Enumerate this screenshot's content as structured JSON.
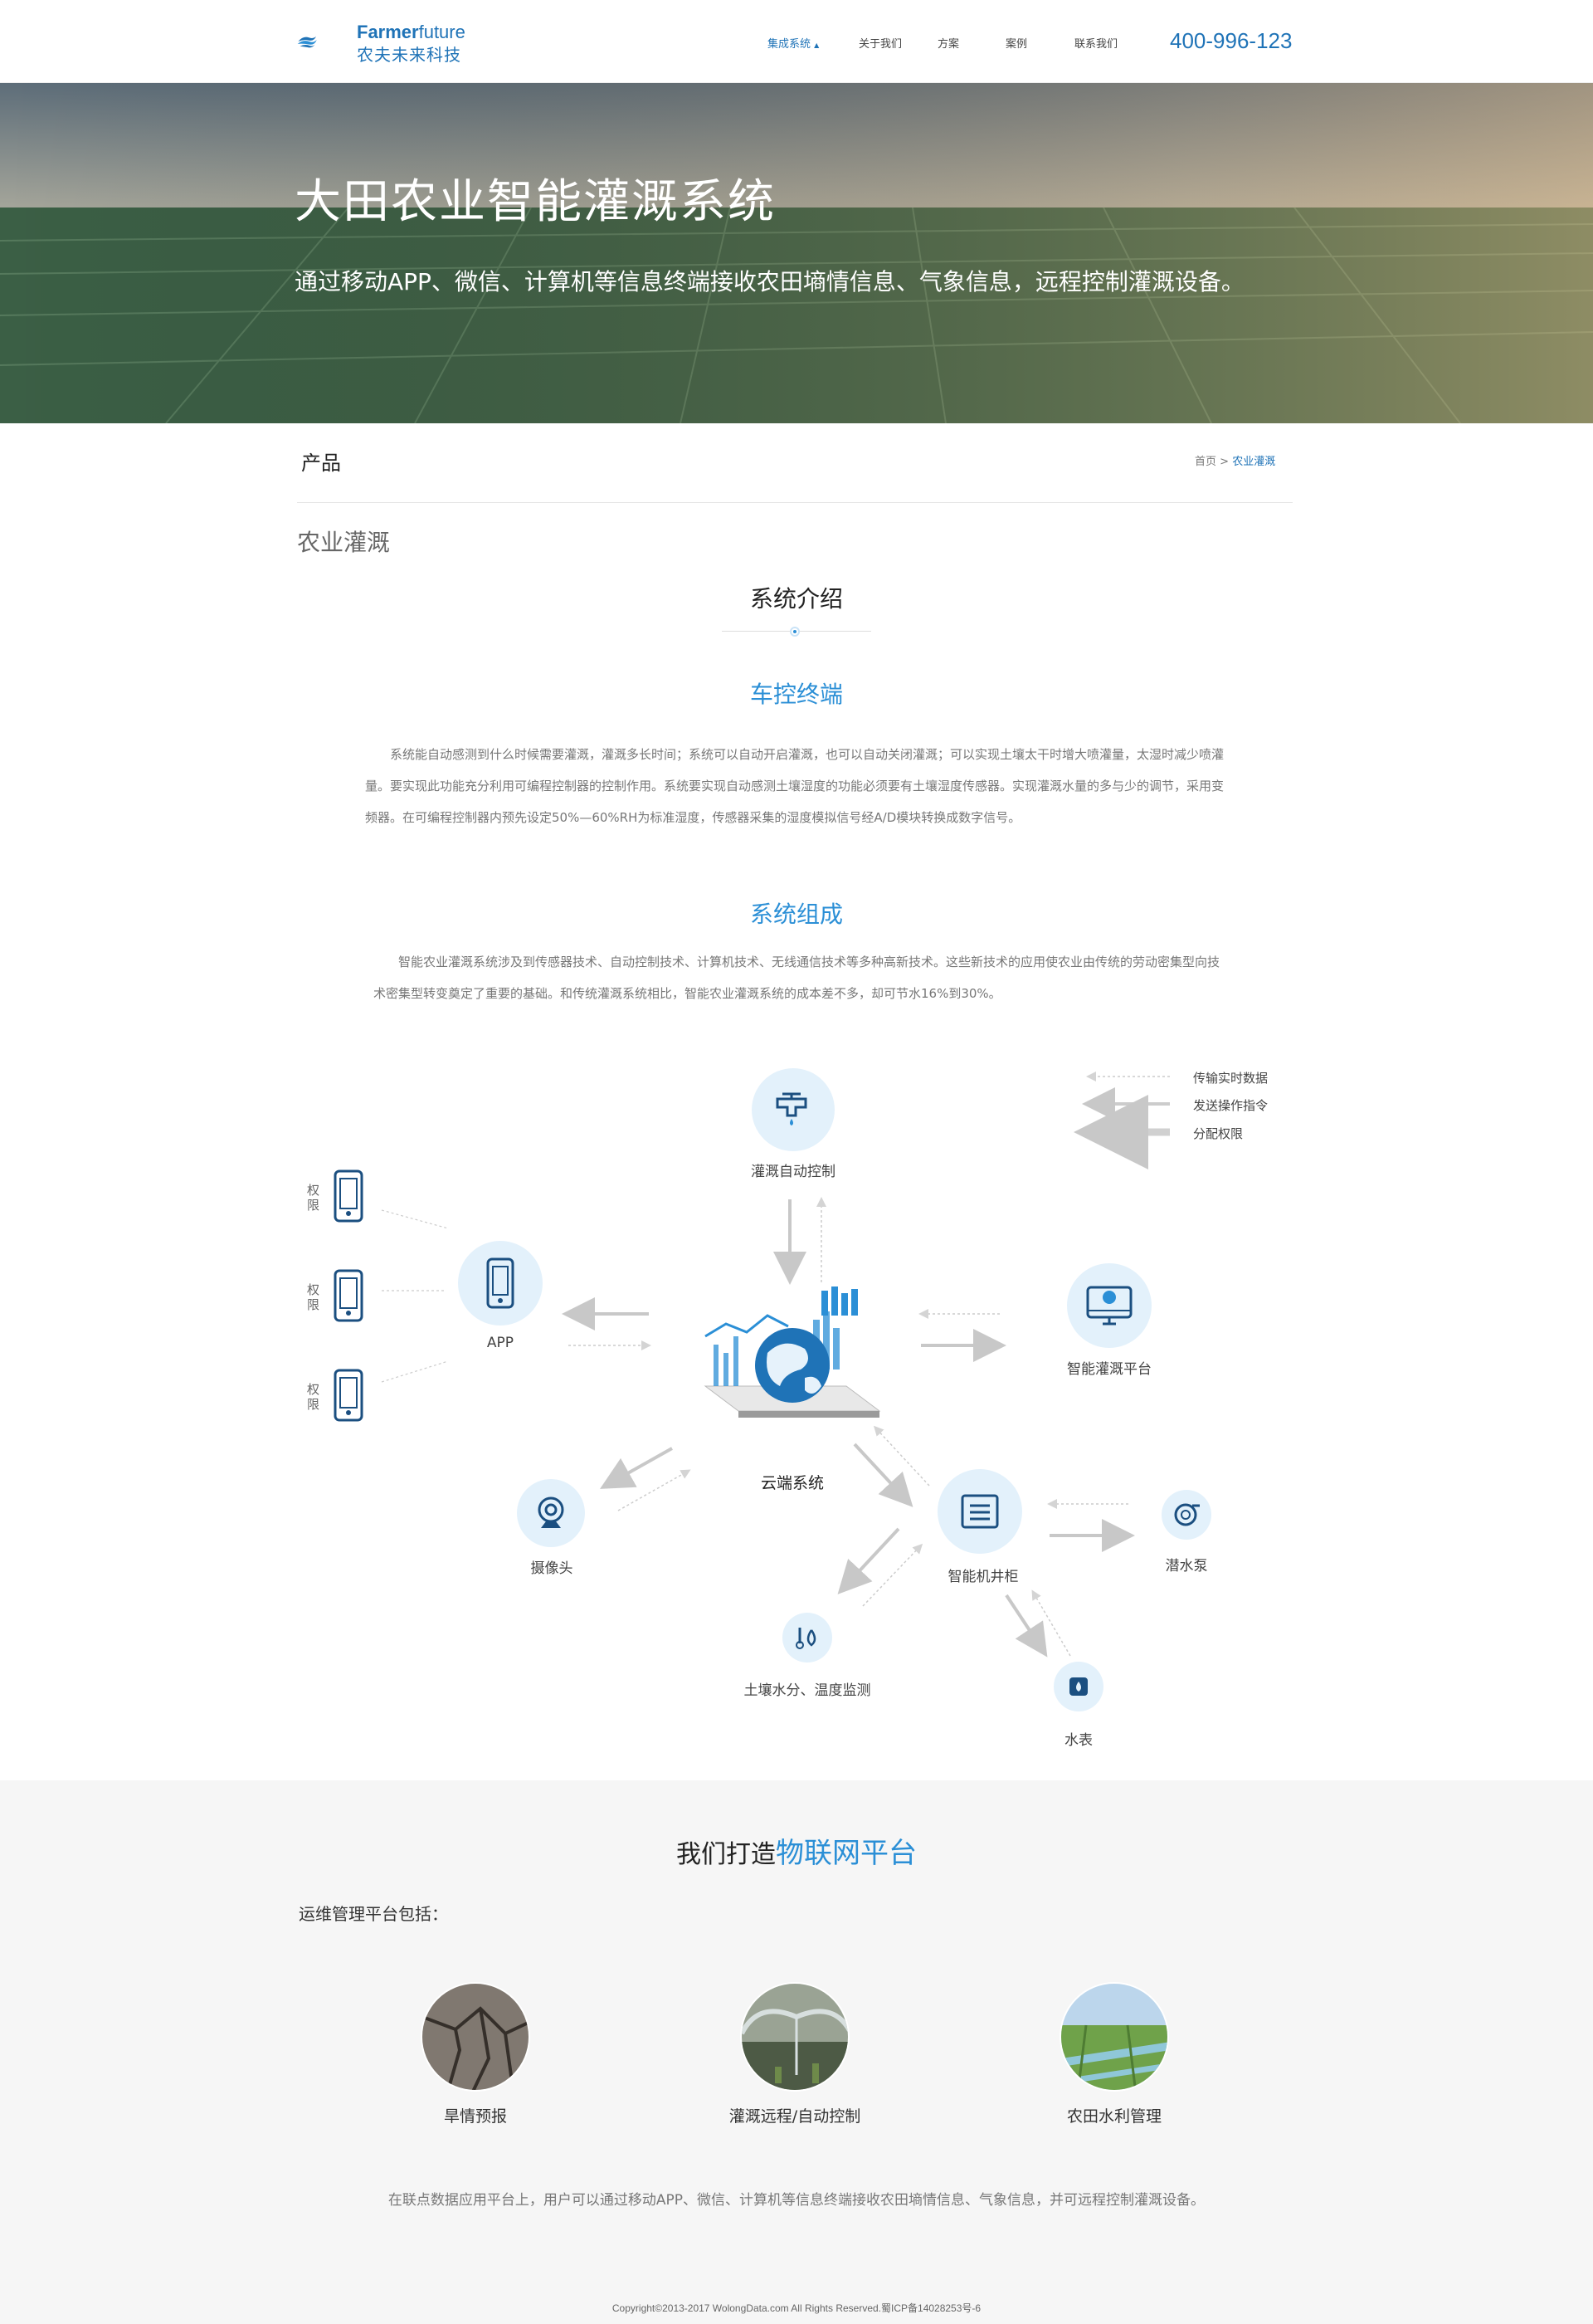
{
  "header": {
    "logo_en_a": "Farmer",
    "logo_en_b": "future",
    "logo_cn": "农夫未来科技",
    "nav": [
      {
        "label": "集成系统"
      },
      {
        "label": "关于我们"
      },
      {
        "label": "方案"
      },
      {
        "label": "案例"
      },
      {
        "label": "联系我们"
      }
    ],
    "phone": "400-996-123"
  },
  "hero": {
    "title": "大田农业智能灌溉系统",
    "subtitle": "通过移动APP、微信、计算机等信息终端接收农田墒情信息、气象信息，远程控制灌溉设备。"
  },
  "section": {
    "title": "产品",
    "breadcrumb_home": "首页",
    "breadcrumb_sep": ">",
    "breadcrumb_current": "农业灌溉",
    "category": "农业灌溉"
  },
  "intro": {
    "heading": "系统介绍",
    "h_terminal": "车控终端",
    "p_terminal": "系统能自动感测到什么时候需要灌溉，灌溉多长时间；系统可以自动开启灌溉，也可以自动关闭灌溉；可以实现土壤太干时增大喷灌量，太湿时减少喷灌量。要实现此功能充分利用可编程控制器的控制作用。系统要实现自动感测土壤湿度的功能必须要有土壤湿度传感器。实现灌溉水量的多与少的调节，采用变频器。在可编程控制器内预先设定50%—60%RH为标准湿度，传感器采集的湿度模拟信号经A/D模块转换成数字信号。",
    "h_compose": "系统组成",
    "p_compose": "智能农业灌溉系统涉及到传感器技术、自动控制技术、计算机技术、无线通信技术等多种高新技术。这些新技术的应用使农业由传统的劳动密集型向技术密集型转变奠定了重要的基础。和传统灌溉系统相比，智能农业灌溉系统的成本差不多，却可节水16%到30%。"
  },
  "diagram": {
    "legend": [
      {
        "label": "传输实时数据"
      },
      {
        "label": "发送操作指令"
      },
      {
        "label": "分配权限"
      }
    ],
    "permission": "权限",
    "nodes": {
      "irrigation": "灌溉自动控制",
      "app": "APP",
      "cloud": "云端系统",
      "platform": "智能灌溉平台",
      "camera": "摄像头",
      "cabinet": "智能机井柜",
      "pump": "潜水泵",
      "soil": "土壤水分、温度监测",
      "meter": "水表"
    },
    "accent": "#2b8fd6",
    "icon_color": "#1b4f80"
  },
  "platform": {
    "title_a": "我们打造",
    "title_b": "物联网平台",
    "subtitle": "运维管理平台包括：",
    "items": [
      {
        "label": "旱情预报"
      },
      {
        "label": "灌溉远程/自动控制"
      },
      {
        "label": "农田水利管理"
      }
    ],
    "description": "在联点数据应用平台上，用户可以通过移动APP、微信、计算机等信息终端接收农田墒情信息、气象信息，并可远程控制灌溉设备。"
  },
  "footer": {
    "copyright": "Copyright©2013-2017 WolongData.com All Rights Reserved.蜀ICP备14028253号-6"
  }
}
